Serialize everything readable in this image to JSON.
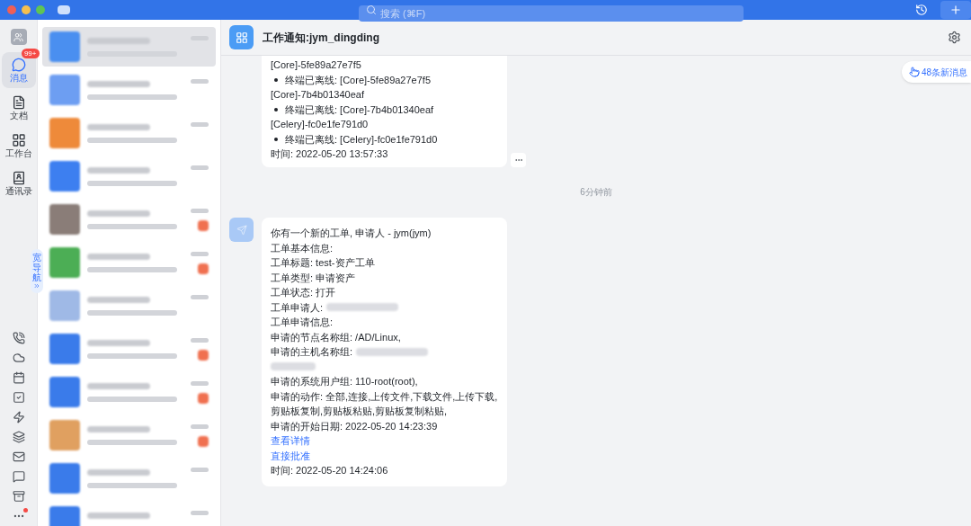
{
  "top_bar": {
    "search": {
      "placeholder": "搜索 (⌘F)"
    }
  },
  "rail": {
    "badge": "99+",
    "items": [
      {
        "kind": "messages",
        "label": "消息",
        "selected": true
      },
      {
        "kind": "docs",
        "label": "文档",
        "selected": false
      },
      {
        "kind": "workbench",
        "label": "工作台",
        "selected": false
      },
      {
        "kind": "contacts",
        "label": "通讯录",
        "selected": false
      }
    ],
    "nav_toggle": "宽导航",
    "more_dot": true
  },
  "chat_list": [
    {
      "color": "#4a8ff0",
      "selected": true,
      "unread": false
    },
    {
      "color": "#6d9ef2",
      "selected": false,
      "unread": false
    },
    {
      "color": "#ee8a3a",
      "selected": false,
      "unread": false
    },
    {
      "color": "#3d7ff0",
      "selected": false,
      "unread": false
    },
    {
      "color": "#8a7d78",
      "selected": false,
      "unread": true
    },
    {
      "color": "#4cae55",
      "selected": false,
      "unread": true
    },
    {
      "color": "#9fb9e6",
      "selected": false,
      "unread": false
    },
    {
      "color": "#3a7bea",
      "selected": false,
      "unread": true
    },
    {
      "color": "#3a7bea",
      "selected": false,
      "unread": true
    },
    {
      "color": "#e0a060",
      "selected": false,
      "unread": true
    },
    {
      "color": "#3a7bea",
      "selected": false,
      "unread": false
    },
    {
      "color": "#3a7bea",
      "selected": false,
      "unread": false
    }
  ],
  "conversation": {
    "title": "工作通知:jym_dingding",
    "new_messages": "48条新消息",
    "messages": [
      {
        "kind": "card",
        "lines": [
          {
            "kind": "text",
            "text": "[Core]-5fe89a27e7f5"
          },
          {
            "kind": "bullet",
            "text": "终端已离线: [Core]-5fe89a27e7f5"
          },
          {
            "kind": "text",
            "text": "[Core]-7b4b01340eaf"
          },
          {
            "kind": "bullet",
            "text": "终端已离线: [Core]-7b4b01340eaf"
          },
          {
            "kind": "text",
            "text": "[Celery]-fc0e1fe791d0"
          },
          {
            "kind": "bullet",
            "text": "终端已离线: [Celery]-fc0e1fe791d0"
          },
          {
            "kind": "text",
            "text": "时间: 2022-05-20 13:57:33"
          }
        ]
      },
      {
        "kind": "divider",
        "text": "6分钟前"
      },
      {
        "kind": "avatar_card",
        "lines": [
          {
            "kind": "text",
            "text": "你有一个新的工单, 申请人 - jym(jym)"
          },
          {
            "kind": "text",
            "text": "工单基本信息:"
          },
          {
            "kind": "text",
            "text": "工单标题: test-资产工单"
          },
          {
            "kind": "text",
            "text": "工单类型: 申请资产"
          },
          {
            "kind": "text",
            "text": "工单状态: 打开"
          },
          {
            "kind": "redacted",
            "text": "工单申请人:"
          },
          {
            "kind": "text",
            "text": "工单申请信息:"
          },
          {
            "kind": "text",
            "text": "申请的节点名称组: /AD/Linux,"
          },
          {
            "kind": "redacted",
            "text": "申请的主机名称组:"
          },
          {
            "kind": "blur"
          },
          {
            "kind": "text",
            "text": "申请的系统用户组: 110-root(root),"
          },
          {
            "kind": "text",
            "text": "申请的动作: 全部,连接,上传文件,下载文件,上传下载,"
          },
          {
            "kind": "text",
            "text": "剪贴板复制,剪贴板粘贴,剪贴板复制粘贴,"
          },
          {
            "kind": "text",
            "text": "申请的开始日期: 2022-05-20 14:23:39"
          },
          {
            "kind": "link",
            "text": "查看详情"
          },
          {
            "kind": "link",
            "text": "直接批准"
          },
          {
            "kind": "text",
            "text": "时间: 2022-05-20 14:24:06"
          }
        ]
      }
    ]
  }
}
